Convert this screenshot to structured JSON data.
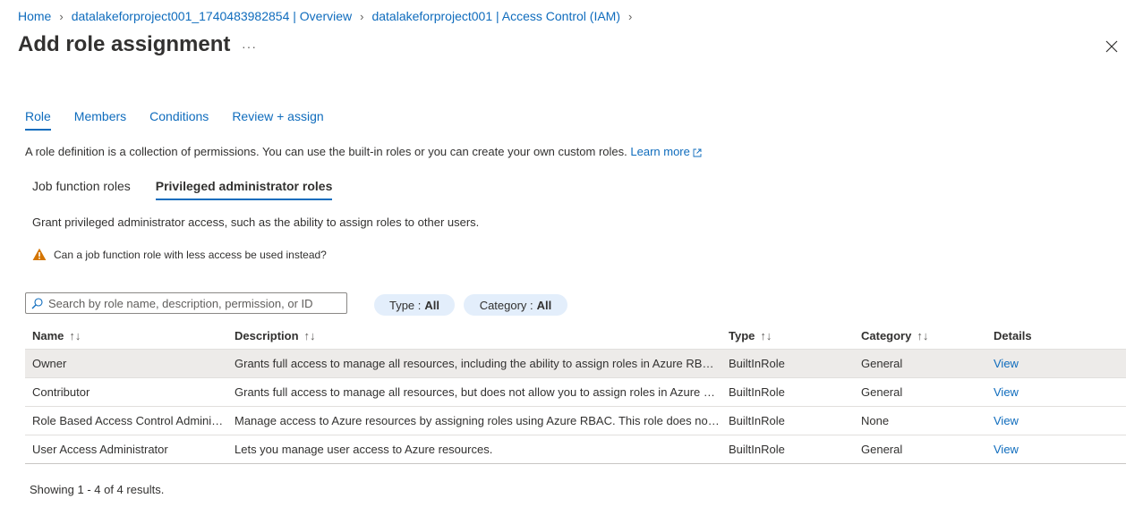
{
  "breadcrumb": [
    {
      "label": "Home"
    },
    {
      "label": "datalakeforproject001_1740483982854 | Overview"
    },
    {
      "label": "datalakeforproject001 | Access Control (IAM)"
    }
  ],
  "header": {
    "title": "Add role assignment",
    "more": "···"
  },
  "tabs": [
    {
      "label": "Role"
    },
    {
      "label": "Members"
    },
    {
      "label": "Conditions"
    },
    {
      "label": "Review + assign"
    }
  ],
  "description": {
    "text": "A role definition is a collection of permissions. You can use the built-in roles or you can create your own custom roles.",
    "link": "Learn more"
  },
  "subtabs": [
    {
      "label": "Job function roles"
    },
    {
      "label": "Privileged administrator roles"
    }
  ],
  "grant_text": "Grant privileged administrator access, such as the ability to assign roles to other users.",
  "warning": {
    "text": "Can a job function role with less access be used instead?"
  },
  "search": {
    "placeholder": "Search by role name, description, permission, or ID",
    "value": ""
  },
  "filters": {
    "type": {
      "label": "Type :",
      "value": "All"
    },
    "category": {
      "label": "Category :",
      "value": "All"
    }
  },
  "table": {
    "columns": [
      {
        "label": "Name",
        "sort": "↑↓"
      },
      {
        "label": "Description",
        "sort": "↑↓"
      },
      {
        "label": "Type",
        "sort": "↑↓"
      },
      {
        "label": "Category",
        "sort": "↑↓"
      },
      {
        "label": "Details",
        "sort": ""
      }
    ],
    "rows": [
      {
        "name": "Owner",
        "description": "Grants full access to manage all resources, including the ability to assign roles in Azure RBAC.",
        "type": "BuiltInRole",
        "category": "General",
        "details": "View"
      },
      {
        "name": "Contributor",
        "description": "Grants full access to manage all resources, but does not allow you to assign roles in Azure RB...",
        "type": "BuiltInRole",
        "category": "General",
        "details": "View"
      },
      {
        "name": "Role Based Access Control Administ...",
        "description": "Manage access to Azure resources by assigning roles using Azure RBAC. This role does not al...",
        "type": "BuiltInRole",
        "category": "None",
        "details": "View"
      },
      {
        "name": "User Access Administrator",
        "description": "Lets you manage user access to Azure resources.",
        "type": "BuiltInRole",
        "category": "General",
        "details": "View"
      }
    ]
  },
  "footer": {
    "text": "Showing 1 - 4 of 4 results."
  },
  "colors": {
    "accent": "#0f6cbd",
    "warning": "#d47500",
    "pill_bg": "#e3eefb",
    "selected_row": "#edebe9"
  }
}
